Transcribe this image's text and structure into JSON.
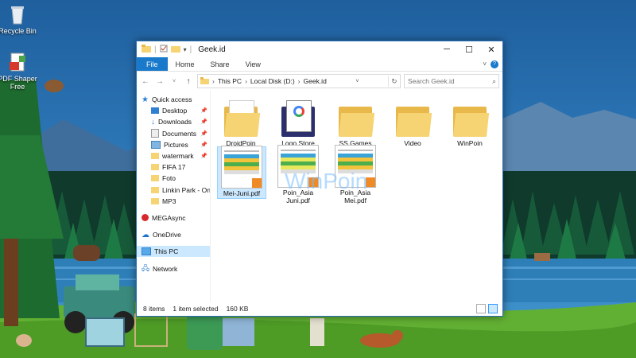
{
  "desktop": {
    "icons": [
      {
        "label": "Recycle Bin",
        "icon": "recycle-bin-icon"
      },
      {
        "label": "PDF Shaper Free",
        "icon": "pdf-shaper-icon"
      }
    ],
    "watermark": "WinPoin"
  },
  "window": {
    "title": "Geek.id",
    "controls": {
      "minimize": "─",
      "maximize": "☐",
      "close": "✕"
    },
    "ribbon_tabs": [
      "File",
      "Home",
      "Share",
      "View"
    ],
    "address": {
      "segments": [
        "This PC",
        "Local Disk (D:)",
        "Geek.id"
      ]
    },
    "search": {
      "placeholder": "Search Geek.id"
    },
    "navigation": {
      "quick_access": "Quick access",
      "pinned": [
        "Desktop",
        "Downloads",
        "Documents",
        "Pictures",
        "watermark"
      ],
      "recent": [
        "FIFA 17",
        "Foto",
        "Linkin Park - One M",
        "MP3"
      ],
      "megasync": "MEGAsync",
      "onedrive": "OneDrive",
      "this_pc": "This PC",
      "network": "Network"
    },
    "files": [
      {
        "name": "DroidPoin",
        "type": "folder"
      },
      {
        "name": "Logo Store",
        "type": "folder"
      },
      {
        "name": "SS Games",
        "type": "folder"
      },
      {
        "name": "Video",
        "type": "folder"
      },
      {
        "name": "WinPoin",
        "type": "folder"
      },
      {
        "name": "Mei-Juni.pdf",
        "type": "pdf",
        "selected": true
      },
      {
        "name": "Poin_Asia Juni.pdf",
        "type": "pdf"
      },
      {
        "name": "Poin_Asia Mei.pdf",
        "type": "pdf"
      }
    ],
    "status": {
      "items": "8 items",
      "selected": "1 item selected",
      "size": "160 KB"
    }
  },
  "colors": {
    "accent": "#1979ca",
    "selection": "#cce8ff",
    "folder": "#f6d474"
  }
}
